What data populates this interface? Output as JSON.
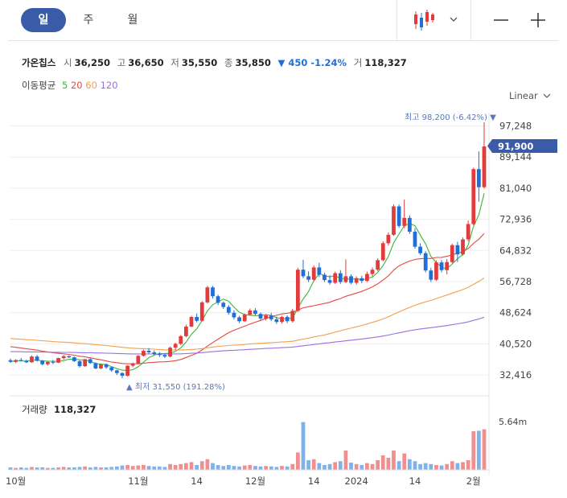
{
  "tabs": [
    {
      "label": "일"
    },
    {
      "label": "주"
    },
    {
      "label": "월"
    }
  ],
  "stock": {
    "name": "가온칩스",
    "open_label": "시",
    "open": "36,250",
    "high_label": "고",
    "high": "36,650",
    "low_label": "저",
    "low": "35,550",
    "close_label": "종",
    "close": "35,850",
    "change": "▼ 450 -1.24%",
    "volume_label": "거",
    "volume": "118,327"
  },
  "ma": {
    "label": "이동평균",
    "periods": [
      "5",
      "20",
      "60",
      "120"
    ],
    "colors": [
      "#3db53d",
      "#e6493f",
      "#f0a050",
      "#9b6fe0"
    ]
  },
  "scale_label": "Linear",
  "colors": {
    "up": "#e23b3b",
    "down": "#1e6fd9",
    "accent": "#3a5ba8"
  },
  "chart_data": {
    "type": "candlestick",
    "y_ticks": [
      "97,248",
      "89,144",
      "81,040",
      "72,936",
      "64,832",
      "56,728",
      "48,624",
      "40,520",
      "32,416"
    ],
    "y_tick_values": [
      97248,
      89144,
      81040,
      72936,
      64832,
      56728,
      48624,
      40520,
      32416
    ],
    "x_tick_labels": [
      "10월",
      "11월",
      "14",
      "12월",
      "14",
      "2024",
      "14",
      "2월"
    ],
    "current_price_label": "91,900",
    "high_annotation": "최고 98,200 (-6.42%) ▼",
    "low_annotation": "▲ 최저 31,550 (191.28%)",
    "volume_title": "거래량",
    "volume_value": "118,327",
    "volume_max_label": "5.64m",
    "candles": [
      [
        36250,
        36650,
        35550,
        35850
      ],
      [
        35800,
        36500,
        35500,
        36300
      ],
      [
        36300,
        36800,
        35900,
        36100
      ],
      [
        36100,
        36400,
        35500,
        35700
      ],
      [
        35700,
        37500,
        35600,
        37200
      ],
      [
        37200,
        37600,
        35900,
        36100
      ],
      [
        36100,
        36300,
        34900,
        35200
      ],
      [
        35200,
        36000,
        34800,
        35800
      ],
      [
        35800,
        36300,
        35200,
        35600
      ],
      [
        35600,
        36900,
        35500,
        36800
      ],
      [
        36800,
        37600,
        36400,
        37300
      ],
      [
        37300,
        37500,
        36800,
        37000
      ],
      [
        37000,
        37200,
        35800,
        36000
      ],
      [
        36000,
        36200,
        34300,
        34700
      ],
      [
        34700,
        36600,
        34500,
        36500
      ],
      [
        36500,
        36800,
        35300,
        35500
      ],
      [
        35500,
        35700,
        33900,
        34100
      ],
      [
        34100,
        35400,
        33900,
        35200
      ],
      [
        35200,
        35400,
        34000,
        34400
      ],
      [
        34400,
        34600,
        33200,
        33600
      ],
      [
        33600,
        33800,
        32400,
        32900
      ],
      [
        32900,
        33100,
        31550,
        32200
      ],
      [
        32200,
        35000,
        32000,
        34800
      ],
      [
        34800,
        35600,
        34400,
        35400
      ],
      [
        35400,
        37600,
        35200,
        37400
      ],
      [
        37400,
        39000,
        37200,
        38700
      ],
      [
        38700,
        39400,
        37900,
        38300
      ],
      [
        38300,
        38800,
        37600,
        37900
      ],
      [
        37900,
        38400,
        37100,
        37600
      ],
      [
        37600,
        38100,
        36800,
        37200
      ],
      [
        37200,
        39800,
        37000,
        39500
      ],
      [
        39500,
        40800,
        38900,
        40500
      ],
      [
        40500,
        42800,
        40200,
        42500
      ],
      [
        42500,
        45500,
        42200,
        45000
      ],
      [
        45000,
        47800,
        44800,
        47500
      ],
      [
        47500,
        48400,
        46100,
        46500
      ],
      [
        46500,
        51600,
        46300,
        51300
      ],
      [
        51300,
        55600,
        51000,
        55200
      ],
      [
        55200,
        55600,
        52300,
        52900
      ],
      [
        52900,
        53300,
        50600,
        51200
      ],
      [
        51200,
        51500,
        49600,
        50100
      ],
      [
        50100,
        50600,
        48100,
        48600
      ],
      [
        48600,
        49300,
        46900,
        47400
      ],
      [
        47400,
        47800,
        45900,
        46400
      ],
      [
        46400,
        48400,
        46200,
        48100
      ],
      [
        48100,
        49700,
        47900,
        49200
      ],
      [
        49200,
        49800,
        47900,
        48300
      ],
      [
        48300,
        48700,
        46600,
        47100
      ],
      [
        47100,
        48300,
        46600,
        47900
      ],
      [
        47900,
        48600,
        46400,
        46900
      ],
      [
        46900,
        47600,
        45700,
        46200
      ],
      [
        46200,
        47800,
        45800,
        47500
      ],
      [
        47500,
        47900,
        45900,
        46400
      ],
      [
        46400,
        49600,
        46000,
        49100
      ],
      [
        49100,
        60300,
        48800,
        59800
      ],
      [
        59800,
        62400,
        57600,
        58100
      ],
      [
        58100,
        59400,
        56600,
        57200
      ],
      [
        57200,
        60900,
        56900,
        60400
      ],
      [
        60400,
        61600,
        57900,
        58500
      ],
      [
        58500,
        59000,
        56600,
        57100
      ],
      [
        57100,
        58400,
        55900,
        56400
      ],
      [
        56400,
        59300,
        56100,
        58900
      ],
      [
        58900,
        59700,
        56100,
        56600
      ],
      [
        56600,
        62500,
        56300,
        58100
      ],
      [
        58100,
        58600,
        56000,
        56400
      ],
      [
        56400,
        58100,
        55900,
        57600
      ],
      [
        57600,
        58200,
        56300,
        56900
      ],
      [
        56900,
        59300,
        56600,
        58700
      ],
      [
        58700,
        60400,
        58100,
        59800
      ],
      [
        59800,
        62800,
        59400,
        62300
      ],
      [
        62300,
        67200,
        62000,
        66700
      ],
      [
        66700,
        69500,
        66100,
        68900
      ],
      [
        68900,
        76800,
        68600,
        76300
      ],
      [
        76300,
        76800,
        70700,
        71200
      ],
      [
        71200,
        78100,
        70600,
        73300
      ],
      [
        73300,
        74000,
        69100,
        69700
      ],
      [
        69700,
        70600,
        65300,
        65800
      ],
      [
        65800,
        66700,
        63600,
        64100
      ],
      [
        64100,
        64600,
        59100,
        59600
      ],
      [
        59600,
        60300,
        56600,
        57200
      ],
      [
        57200,
        62200,
        56900,
        61700
      ],
      [
        61700,
        62300,
        59100,
        59700
      ],
      [
        59700,
        62600,
        58600,
        61800
      ],
      [
        61800,
        66600,
        61500,
        66200
      ],
      [
        66200,
        67100,
        61800,
        63800
      ],
      [
        63800,
        68200,
        63500,
        67700
      ],
      [
        67700,
        72600,
        67200,
        71700
      ],
      [
        71700,
        86400,
        71400,
        86000
      ],
      [
        86000,
        90600,
        77500,
        81300
      ],
      [
        81300,
        98200,
        80900,
        91900
      ]
    ],
    "volume": [
      0.05,
      0.04,
      0.05,
      0.04,
      0.06,
      0.05,
      0.05,
      0.04,
      0.04,
      0.05,
      0.06,
      0.05,
      0.05,
      0.06,
      0.07,
      0.05,
      0.06,
      0.05,
      0.05,
      0.06,
      0.07,
      0.09,
      0.1,
      0.08,
      0.09,
      0.1,
      0.08,
      0.07,
      0.07,
      0.06,
      0.12,
      0.1,
      0.12,
      0.14,
      0.16,
      0.1,
      0.18,
      0.22,
      0.14,
      0.1,
      0.08,
      0.1,
      0.08,
      0.07,
      0.09,
      0.1,
      0.08,
      0.07,
      0.08,
      0.07,
      0.06,
      0.08,
      0.07,
      0.12,
      0.36,
      0.99,
      0.2,
      0.22,
      0.14,
      0.1,
      0.12,
      0.16,
      0.18,
      0.4,
      0.15,
      0.12,
      0.1,
      0.14,
      0.12,
      0.2,
      0.3,
      0.25,
      0.4,
      0.18,
      0.34,
      0.22,
      0.18,
      0.12,
      0.14,
      0.12,
      0.1,
      0.09,
      0.12,
      0.18,
      0.14,
      0.16,
      0.2,
      0.8,
      0.81,
      0.84
    ]
  }
}
